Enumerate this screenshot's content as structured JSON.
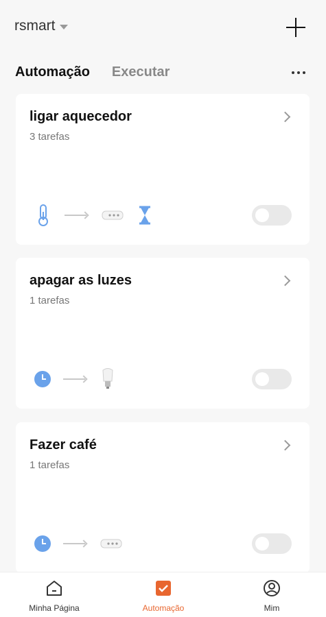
{
  "header": {
    "account_name": "rsmart"
  },
  "tabs": [
    {
      "label": "Automação",
      "active": true
    },
    {
      "label": "Executar",
      "active": false
    }
  ],
  "automations": [
    {
      "title": "ligar aquecedor",
      "subtitle": "3 tarefas",
      "enabled": false,
      "icons": [
        "thermometer-icon",
        "arrow-icon",
        "power-strip-icon",
        "hourglass-icon"
      ]
    },
    {
      "title": "apagar as luzes",
      "subtitle": "1 tarefas",
      "enabled": false,
      "icons": [
        "clock-icon",
        "arrow-icon",
        "bulb-icon"
      ]
    },
    {
      "title": "Fazer café",
      "subtitle": "1 tarefas",
      "enabled": false,
      "icons": [
        "clock-icon",
        "arrow-icon",
        "power-strip-icon"
      ]
    }
  ],
  "bottom_nav": {
    "home_label": "Minha Página",
    "automation_label": "Automação",
    "me_label": "Mim"
  },
  "colors": {
    "accent": "#e8662f",
    "icon_blue": "#6aa2ea",
    "background": "#f7f7f7"
  }
}
